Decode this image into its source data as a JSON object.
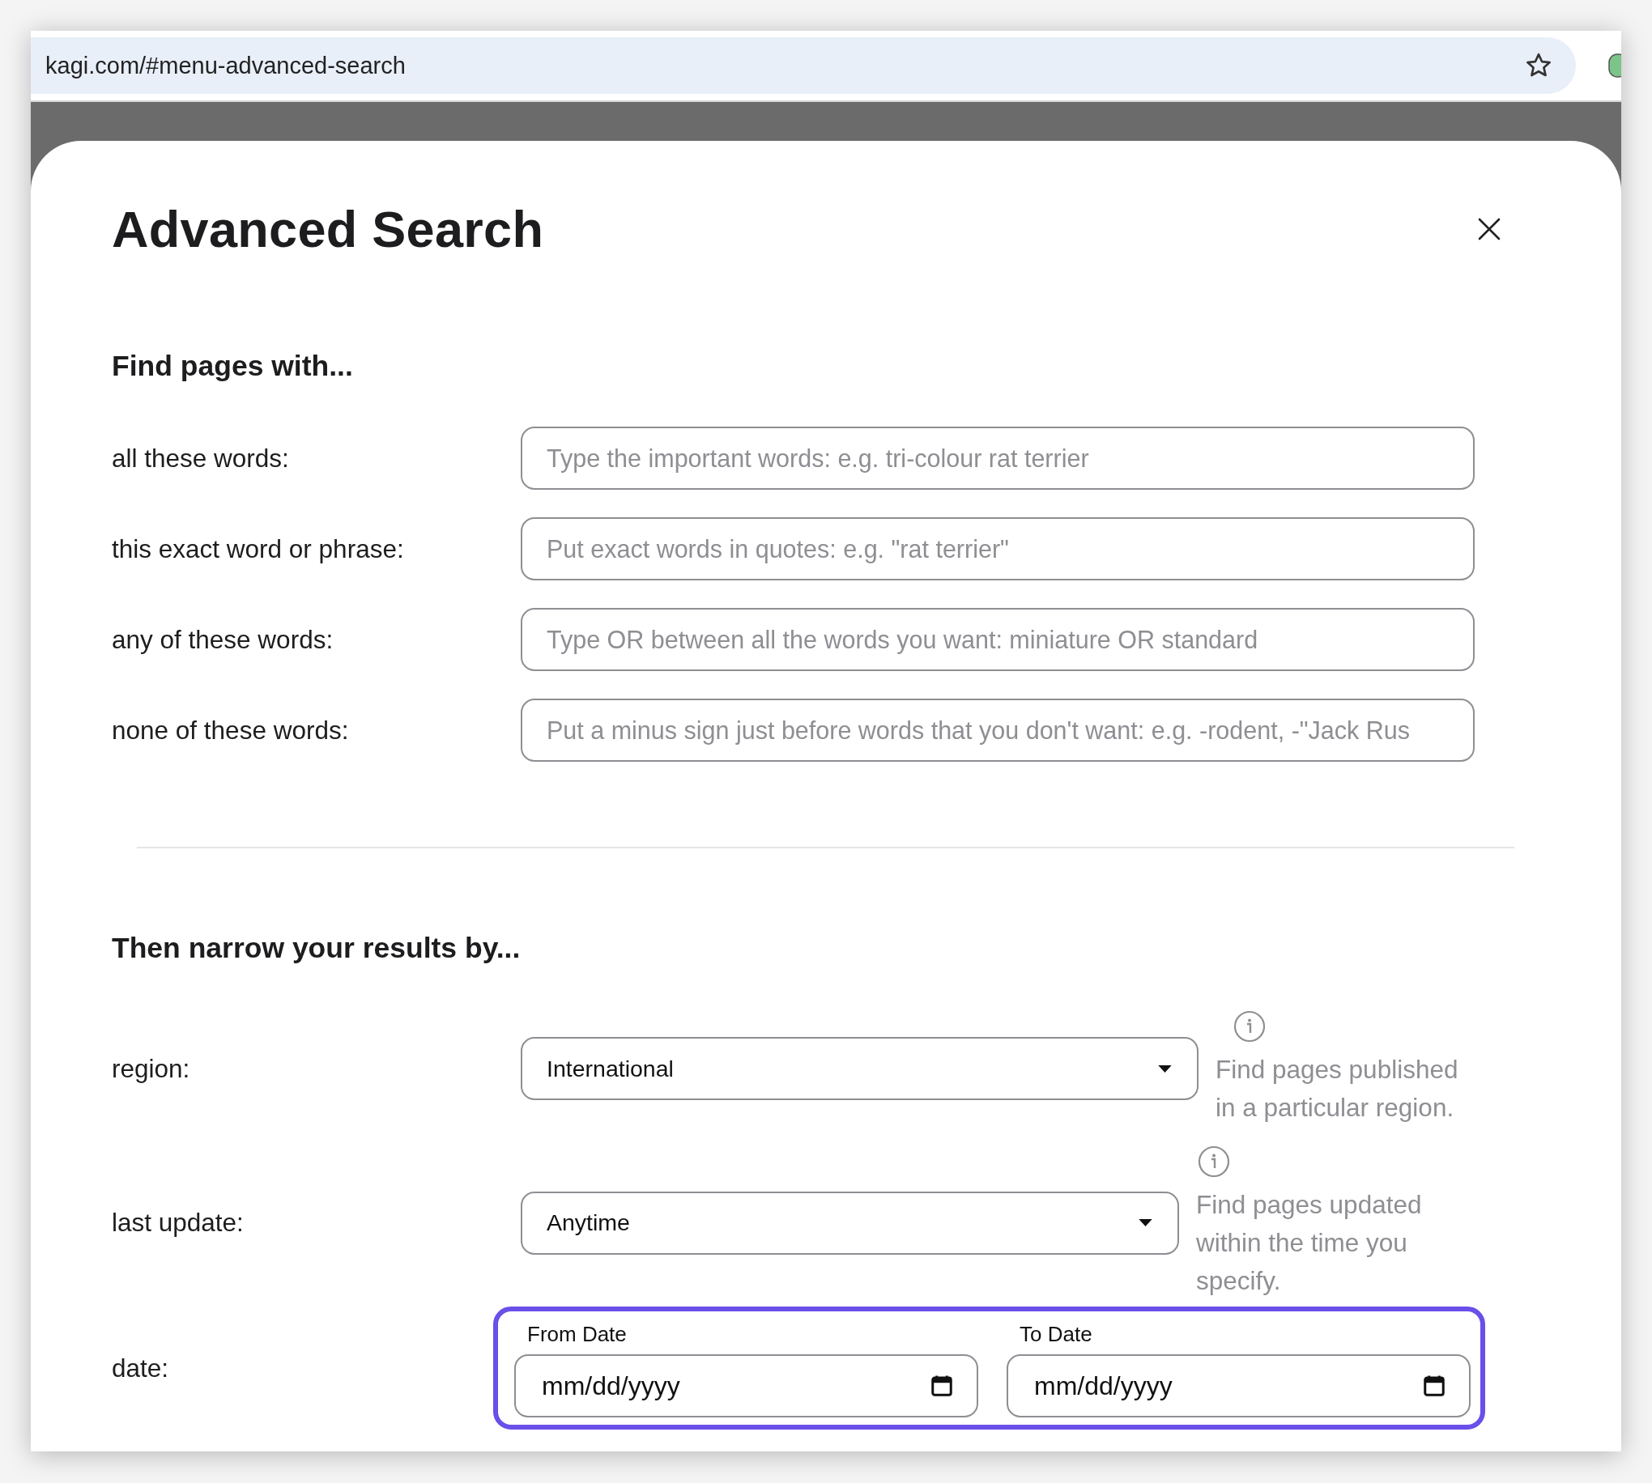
{
  "browser": {
    "url": "kagi.com/#menu-advanced-search"
  },
  "dialog": {
    "title": "Advanced Search",
    "find": {
      "heading": "Find pages with...",
      "fields": [
        {
          "label": "all these words:",
          "placeholder": "Type the important words: e.g. tri-colour rat terrier"
        },
        {
          "label": "this exact word or phrase:",
          "placeholder": "Put exact words in quotes: e.g. \"rat terrier\""
        },
        {
          "label": "any of these words:",
          "placeholder": "Type OR between all the words you want: miniature OR standard"
        },
        {
          "label": "none of these words:",
          "placeholder": "Put a minus sign just before words that you don't want: e.g. -rodent, -\"Jack Rus"
        }
      ]
    },
    "narrow": {
      "heading": "Then narrow your results by...",
      "rows": [
        {
          "kind": "select",
          "label": "region:",
          "value": "International",
          "help": "Find pages published in a particular region."
        },
        {
          "kind": "select",
          "label": "last update:",
          "value": "Anytime",
          "help": "Find pages updated within the time you specify."
        },
        {
          "kind": "date_range",
          "label": "date:",
          "highlighted": true,
          "inputs": [
            {
              "label": "From Date",
              "placeholder": "mm/dd/yyyy"
            },
            {
              "label": "To Date",
              "placeholder": "mm/dd/yyyy"
            }
          ]
        }
      ]
    }
  }
}
